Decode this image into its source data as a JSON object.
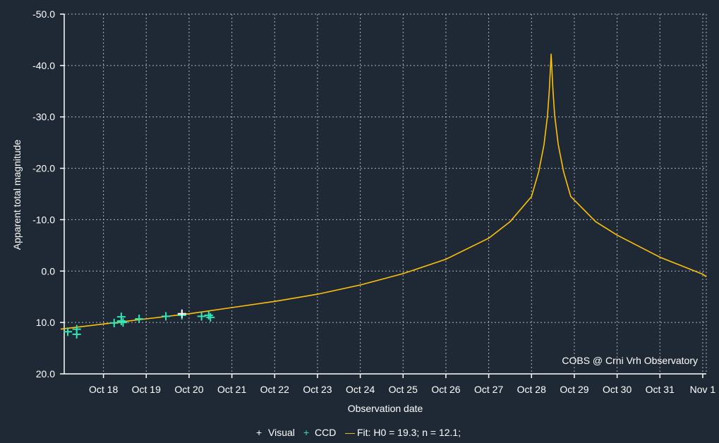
{
  "chart_data": {
    "type": "scatter",
    "title": "",
    "xlabel": "Observation date",
    "ylabel": "Apparent total magnitude",
    "x_ticks": [
      {
        "date": "2024-10-18",
        "label": "Oct 18"
      },
      {
        "date": "2024-10-19",
        "label": "Oct 19"
      },
      {
        "date": "2024-10-20",
        "label": "Oct 20"
      },
      {
        "date": "2024-10-21",
        "label": "Oct 21"
      },
      {
        "date": "2024-10-22",
        "label": "Oct 22"
      },
      {
        "date": "2024-10-23",
        "label": "Oct 23"
      },
      {
        "date": "2024-10-24",
        "label": "Oct 24"
      },
      {
        "date": "2024-10-25",
        "label": "Oct 25"
      },
      {
        "date": "2024-10-26",
        "label": "Oct 26"
      },
      {
        "date": "2024-10-27",
        "label": "Oct 27"
      },
      {
        "date": "2024-10-28",
        "label": "Oct 28"
      },
      {
        "date": "2024-10-29",
        "label": "Oct 29"
      },
      {
        "date": "2024-10-30",
        "label": "Oct 30"
      },
      {
        "date": "2024-10-31",
        "label": "Oct 31"
      },
      {
        "date": "2024-11-01",
        "label": "Nov 1"
      }
    ],
    "xlim": [
      "2024-10-17T02:00",
      "2024-11-01T02:00"
    ],
    "y_ticks": [
      {
        "value": -50,
        "label": "-50.0"
      },
      {
        "value": -40,
        "label": "-40.0"
      },
      {
        "value": -30,
        "label": "-30.0"
      },
      {
        "value": -20,
        "label": "-20.0"
      },
      {
        "value": -10,
        "label": "-10.0"
      },
      {
        "value": 0,
        "label": "0.0"
      },
      {
        "value": 10,
        "label": "10.0"
      },
      {
        "value": 20,
        "label": "20.0"
      }
    ],
    "ylim": [
      -50,
      20
    ],
    "y_inverted": true,
    "grid": true,
    "legend_position": "bottom-center",
    "series": [
      {
        "name": "Visual",
        "kind": "scatter",
        "color": "#ffffff",
        "points": [
          {
            "x": "2024-10-19T20:00",
            "y": 8.3
          }
        ]
      },
      {
        "name": "CCD",
        "kind": "scatter",
        "color": "#2ee6b6",
        "points": [
          {
            "x": "2024-10-17T04:00",
            "y": 11.8
          },
          {
            "x": "2024-10-17T09:00",
            "y": 11.3
          },
          {
            "x": "2024-10-17T09:00",
            "y": 12.3
          },
          {
            "x": "2024-10-18T06:00",
            "y": 10.1
          },
          {
            "x": "2024-10-18T10:00",
            "y": 9.7
          },
          {
            "x": "2024-10-18T10:00",
            "y": 8.9
          },
          {
            "x": "2024-10-18T11:00",
            "y": 10.0
          },
          {
            "x": "2024-10-18T20:00",
            "y": 9.3
          },
          {
            "x": "2024-10-19T11:00",
            "y": 8.8
          },
          {
            "x": "2024-10-19T20:00",
            "y": 8.6
          },
          {
            "x": "2024-10-20T07:00",
            "y": 8.8
          },
          {
            "x": "2024-10-20T11:00",
            "y": 8.6
          },
          {
            "x": "2024-10-20T12:00",
            "y": 9.0
          }
        ]
      },
      {
        "name": "Fit: H0 = 19.3; n = 12.1;",
        "kind": "line",
        "color": "#ffc107",
        "points": [
          {
            "x": "2024-10-17T00:00",
            "y": 11.3
          },
          {
            "x": "2024-10-18T00:00",
            "y": 10.3
          },
          {
            "x": "2024-10-19T00:00",
            "y": 9.3
          },
          {
            "x": "2024-10-20T00:00",
            "y": 8.3
          },
          {
            "x": "2024-10-21T00:00",
            "y": 7.1
          },
          {
            "x": "2024-10-22T00:00",
            "y": 5.9
          },
          {
            "x": "2024-10-23T00:00",
            "y": 4.5
          },
          {
            "x": "2024-10-24T00:00",
            "y": 2.7
          },
          {
            "x": "2024-10-25T00:00",
            "y": 0.5
          },
          {
            "x": "2024-10-26T00:00",
            "y": -2.3
          },
          {
            "x": "2024-10-27T00:00",
            "y": -6.4
          },
          {
            "x": "2024-10-27T12:00",
            "y": -9.6
          },
          {
            "x": "2024-10-28T00:00",
            "y": -14.5
          },
          {
            "x": "2024-10-28T04:00",
            "y": -19.3
          },
          {
            "x": "2024-10-28T07:00",
            "y": -24.6
          },
          {
            "x": "2024-10-28T09:00",
            "y": -30.3
          },
          {
            "x": "2024-10-28T10:00",
            "y": -35.4
          },
          {
            "x": "2024-10-28T11:00",
            "y": -42.2
          },
          {
            "x": "2024-10-28T12:00",
            "y": -35.4
          },
          {
            "x": "2024-10-28T13:00",
            "y": -30.3
          },
          {
            "x": "2024-10-28T15:00",
            "y": -24.6
          },
          {
            "x": "2024-10-28T18:00",
            "y": -19.3
          },
          {
            "x": "2024-10-28T22:00",
            "y": -14.5
          },
          {
            "x": "2024-10-29T12:00",
            "y": -9.6
          },
          {
            "x": "2024-10-30T00:00",
            "y": -7.0
          },
          {
            "x": "2024-10-31T00:00",
            "y": -2.7
          },
          {
            "x": "2024-11-01T00:00",
            "y": 0.6
          },
          {
            "x": "2024-11-01T02:00",
            "y": 1.1
          }
        ]
      }
    ],
    "annotations": [
      "COBS @ Crni Vrh Observatory"
    ]
  },
  "legend": {
    "visual_label": "Visual",
    "ccd_label": "CCD",
    "fit_label": "Fit: H0 = 19.3; n = 12.1;",
    "visual_symbol": "+",
    "ccd_symbol": "+",
    "fit_symbol": "—"
  },
  "colors": {
    "background": "#1f2935",
    "visual": "#ffffff",
    "ccd": "#2ee6b6",
    "fit": "#ffc107"
  }
}
